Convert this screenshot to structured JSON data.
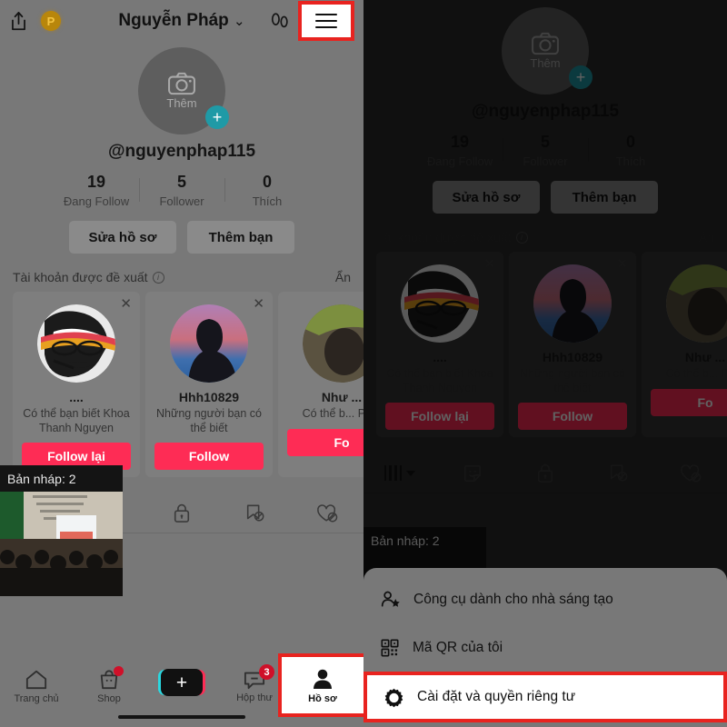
{
  "header": {
    "title": "Nguyễn Pháp",
    "chevron": "⌄",
    "share_icon": "share-icon",
    "pro_badge": "P",
    "footprint_icon": "footprint-icon",
    "menu_icon": "hamburger-menu-icon"
  },
  "profile": {
    "avatar_label": "Thêm",
    "avatar_plus": "+",
    "handle": "@nguyenphap115",
    "stats": [
      {
        "num": "19",
        "label": "Đang Follow"
      },
      {
        "num": "5",
        "label": "Follower"
      },
      {
        "num": "0",
        "label": "Thích"
      }
    ],
    "buttons": [
      {
        "label": "Sửa hồ sơ"
      },
      {
        "label": "Thêm bạn"
      }
    ]
  },
  "suggested": {
    "title": "Tài khoản được đề xuất",
    "info_glyph": "i",
    "hide_label": "Ẩn",
    "close_glyph": "✕",
    "cards": [
      {
        "name": "....",
        "sub": "Có thể bạn biết Khoa Thanh Nguyen",
        "button": "Follow lại",
        "avatar": "portrait-sunglasses"
      },
      {
        "name": "Hhh10829",
        "sub": "Những người bạn có thể biết",
        "button": "Follow",
        "avatar": "silhouette-gradient"
      },
      {
        "name": "Như ...",
        "sub": "Có thể b... Ph...",
        "button": "Fo",
        "avatar": "portrait-dark"
      }
    ]
  },
  "tabs": [
    {
      "name": "posts-grid-tab",
      "icon": "grid-icon"
    },
    {
      "name": "reposts-tab",
      "icon": "sticker-smiley-icon"
    },
    {
      "name": "private-tab",
      "icon": "lock-icon"
    },
    {
      "name": "saved-tab",
      "icon": "bookmark-hidden-icon"
    },
    {
      "name": "liked-tab",
      "icon": "heart-hidden-icon"
    }
  ],
  "draft": {
    "label": "Bản nháp: 2"
  },
  "bottom_nav": [
    {
      "label": "Trang chủ",
      "icon": "home-icon",
      "badge": ""
    },
    {
      "label": "Shop",
      "icon": "shop-bag-icon",
      "badge": "dot"
    },
    {
      "label": "",
      "icon": "create-plus-icon",
      "badge": ""
    },
    {
      "label": "Hộp thư",
      "icon": "inbox-chat-icon",
      "badge": "3"
    },
    {
      "label": "Hồ sơ",
      "icon": "profile-person-icon",
      "badge": ""
    }
  ],
  "sheet_menu": [
    {
      "label": "Công cụ dành cho nhà sáng tạo",
      "icon": "creator-tools-icon",
      "highlighted": false
    },
    {
      "label": "Mã QR của tôi",
      "icon": "qr-code-icon",
      "highlighted": false
    },
    {
      "label": "Cài đặt và quyền riêng tư",
      "icon": "gear-icon",
      "highlighted": true
    }
  ],
  "colors": {
    "highlight_red": "#e8231f",
    "brand_pink": "#fe2c55",
    "teal": "#1f9aa6",
    "badge_red": "#cf1029",
    "panel_left_bg": "#787878",
    "panel_right_bg": "#2b2b2b"
  }
}
